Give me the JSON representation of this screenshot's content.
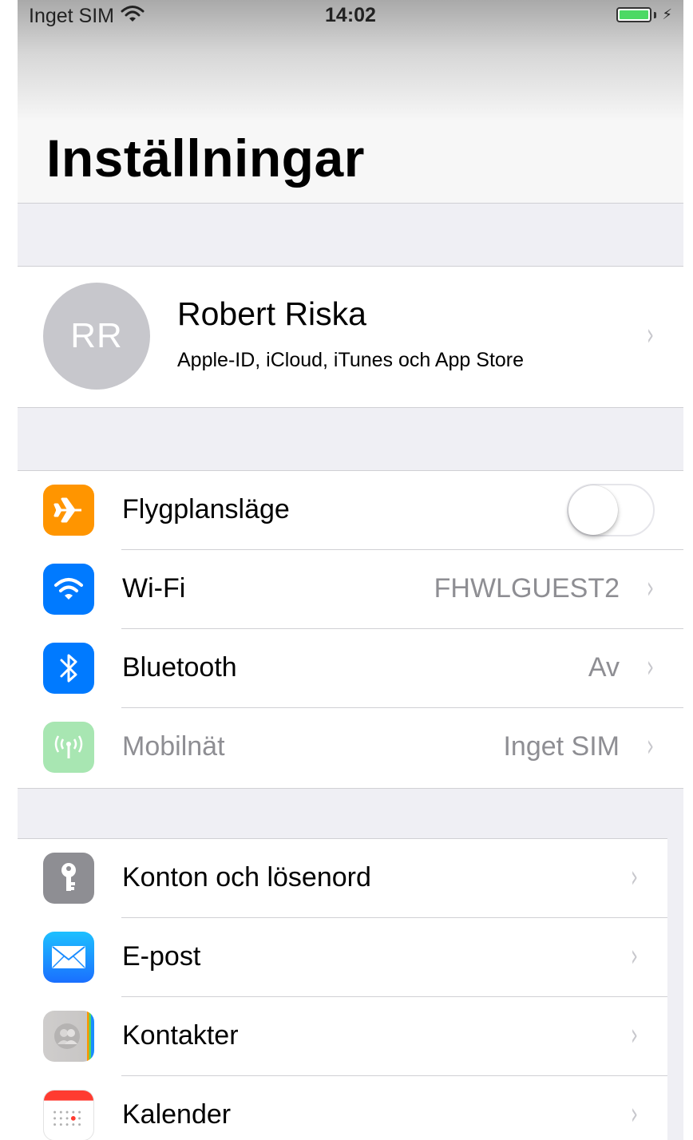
{
  "status_bar": {
    "carrier": "Inget SIM",
    "time": "14:02",
    "battery_color": "#4cd964"
  },
  "header": {
    "title": "Inställningar"
  },
  "profile": {
    "initials": "RR",
    "name": "Robert Riska",
    "subtitle": "Apple-ID, iCloud, iTunes och App Store"
  },
  "connectivity": [
    {
      "label": "Flygplansläge",
      "icon": "airplane-icon",
      "color": "#ff9500",
      "toggle_on": false
    },
    {
      "label": "Wi-Fi",
      "value": "FHWLGUEST2",
      "icon": "wifi-icon",
      "color": "#007aff"
    },
    {
      "label": "Bluetooth",
      "value": "Av",
      "icon": "bluetooth-icon",
      "color": "#007aff"
    },
    {
      "label": "Mobilnät",
      "value": "Inget SIM",
      "icon": "cellular-icon",
      "color": "#a8e6b2",
      "disabled": true
    }
  ],
  "apps": [
    {
      "label": "Konton och lösenord",
      "icon": "key-icon",
      "color": "#8e8e93"
    },
    {
      "label": "E-post",
      "icon": "mail-icon",
      "color": "#1a8cff"
    },
    {
      "label": "Kontakter",
      "icon": "contacts-icon",
      "color": "#d0cfcf"
    },
    {
      "label": "Kalender",
      "icon": "calendar-icon",
      "color": "#ffffff"
    }
  ],
  "chevron": "›"
}
